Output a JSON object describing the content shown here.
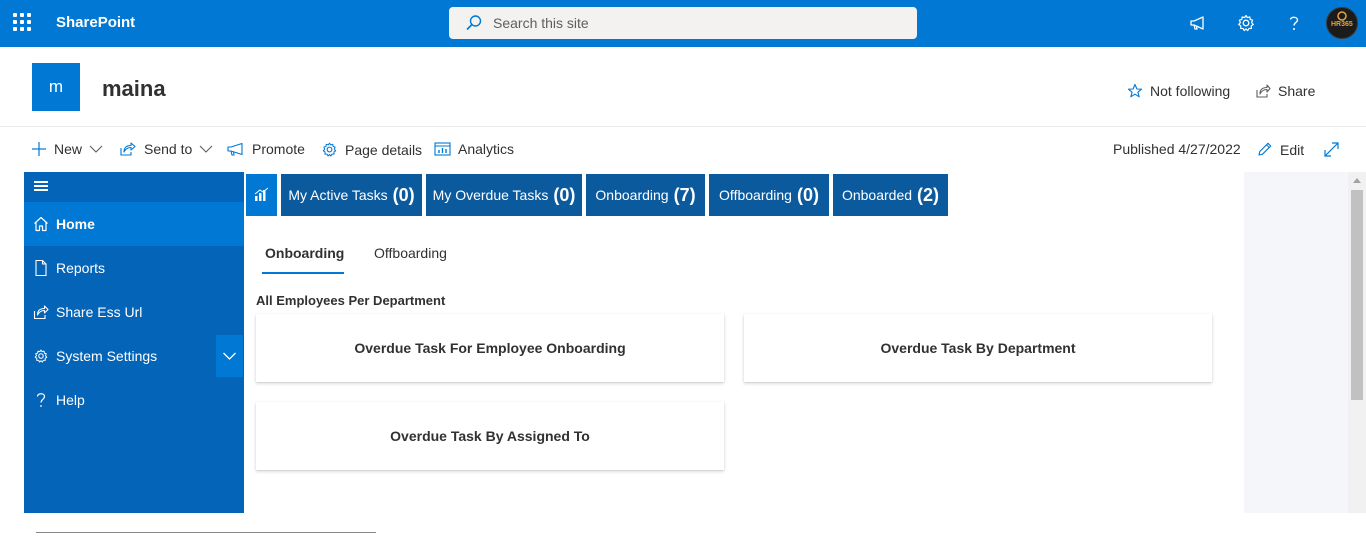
{
  "suitebar": {
    "app_name": "SharePoint",
    "search_placeholder": "Search this site",
    "avatar_text": "HR365",
    "brand_color": "#0078d4"
  },
  "site": {
    "logo_letter": "m",
    "title": "maina",
    "not_following_label": "Not following",
    "share_label": "Share"
  },
  "commandbar": {
    "new_label": "New",
    "send_to_label": "Send to",
    "promote_label": "Promote",
    "page_details_label": "Page details",
    "analytics_label": "Analytics",
    "published_text": "Published 4/27/2022",
    "edit_label": "Edit"
  },
  "leftnav": {
    "items": [
      {
        "label": "Home",
        "icon": "home-icon",
        "active": true
      },
      {
        "label": "Reports",
        "icon": "document-icon",
        "active": false
      },
      {
        "label": "Share Ess Url",
        "icon": "share-icon",
        "active": false
      },
      {
        "label": "System Settings",
        "icon": "gear-icon",
        "active": false
      },
      {
        "label": "Help",
        "icon": "question-icon",
        "active": false
      }
    ],
    "nav_color": "#0364b8"
  },
  "tiles": [
    {
      "label": "My Active Tasks",
      "count": "(0)"
    },
    {
      "label": "My Overdue Tasks",
      "count": "(0)"
    },
    {
      "label": "Onboarding",
      "count": "(7)"
    },
    {
      "label": "Offboarding",
      "count": "(0)"
    },
    {
      "label": "Onboarded",
      "count": "(2)"
    }
  ],
  "pivots": {
    "tab1": "Onboarding",
    "tab2": "Offboarding",
    "selected": "Onboarding"
  },
  "section": {
    "title": "All Employees Per Department"
  },
  "cards": [
    {
      "title": "Overdue Task For Employee Onboarding"
    },
    {
      "title": "Overdue Task By Department"
    },
    {
      "title": "Overdue Task By Assigned To"
    }
  ]
}
